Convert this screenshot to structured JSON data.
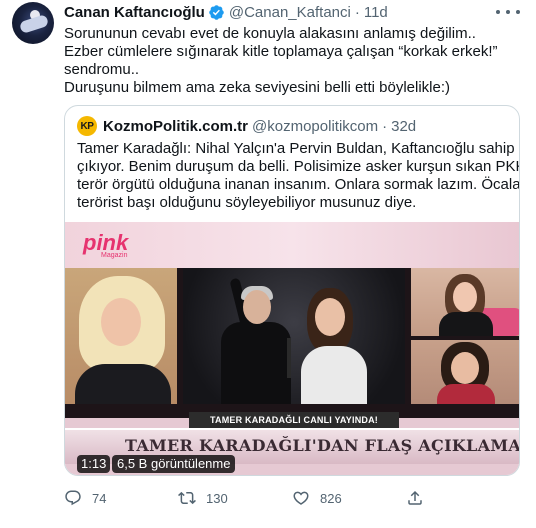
{
  "colors": {
    "text": "#0f1419",
    "secondary": "#536471",
    "verified": "#1d9bf0",
    "border": "#cfd9de",
    "kozmo_logo": "#f5b800",
    "pink_brand": "#e6336f"
  },
  "tweet": {
    "author_name": "Canan Kaftancıoğlu",
    "author_handle": "@Canan_Kaftanci",
    "separator": "·",
    "timestamp": "11d",
    "text_lines": [
      "Sorununun cevabı evet de konuyla alakasını anlamış değilim..",
      "Ezber cümlelere sığınarak kitle toplamaya çalışan “korkak erkek!”",
      "sendromu..",
      "Duruşunu bilmem ama zeka seviyesini belli etti böylelikle:)"
    ],
    "icons": {
      "avatar": "avatar-image",
      "verified": "verified-badge-icon",
      "more": "more-options-icon"
    }
  },
  "quoted_tweet": {
    "logo_text": "KP",
    "author_name": "KozmoPolitik.com.tr",
    "author_handle": "@kozmopolitikcom",
    "separator": "·",
    "timestamp": "32d",
    "text_lines": [
      "Tamer Karadağlı: Nihal Yalçın'a Pervin Buldan, Kaftancıoğlu sahip",
      "çıkıyor. Benim duruşum da belli. Polisimize asker kurşun sıkan PKK'nın",
      "terör örgütü olduğuna inanan insanım. Onlara sormak lazım. Öcalan'ın",
      "terörist başı olduğunu söyleyebiliyor musunuz diye."
    ],
    "video": {
      "channel_logo": "pink",
      "channel_logo_sub": "Magazin",
      "live_banner": "TAMER KARADAĞLI CANLI YAYINDA!",
      "headline": "TAMER KARADAĞLI'DAN FLAŞ AÇIKLAMALAR!",
      "duration": "1:13",
      "views": "6,5 B görüntülenme"
    }
  },
  "actions": {
    "reply": {
      "icon": "reply-icon",
      "count": "74"
    },
    "retweet": {
      "icon": "retweet-icon",
      "count": "130"
    },
    "like": {
      "icon": "like-icon",
      "count": "826"
    },
    "share": {
      "icon": "share-icon",
      "count": ""
    }
  }
}
